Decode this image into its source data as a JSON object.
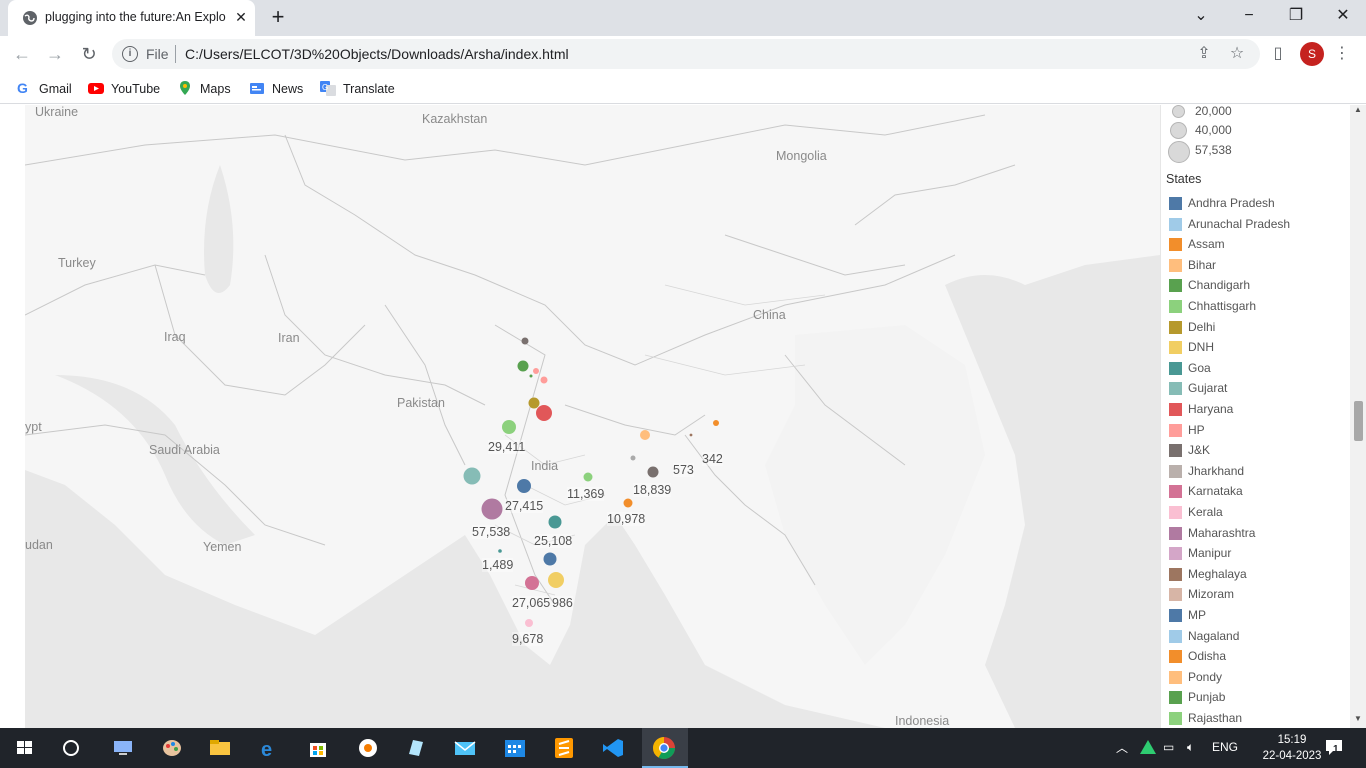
{
  "browser": {
    "tab_title": "plugging into the future:An Explo",
    "url_scheme": "File",
    "url": "C:/Users/ELCOT/3D%20Objects/Downloads/Arsha/index.html",
    "profile_initial": "S",
    "bookmarks": [
      {
        "label": "Gmail",
        "icon": "gmail-icon"
      },
      {
        "label": "YouTube",
        "icon": "youtube-icon"
      },
      {
        "label": "Maps",
        "icon": "maps-icon"
      },
      {
        "label": "News",
        "icon": "news-icon"
      },
      {
        "label": "Translate",
        "icon": "translate-icon"
      }
    ]
  },
  "map": {
    "geo_labels": [
      "Ukraine",
      "Kazakhstan",
      "Mongolia",
      "Turkey",
      "Iraq",
      "Iran",
      "China",
      "Pakistan",
      "ypt",
      "Saudi Arabia",
      "India",
      "Yemen",
      "udan",
      "Indonesia"
    ],
    "bubbles": [
      {
        "state": "Maharashtra",
        "value": 57538,
        "label": "57,538",
        "color": "#b07aa1"
      },
      {
        "state": "Haryana",
        "value": 29411,
        "label": "29,411",
        "color": "#e15759"
      },
      {
        "state": "MP",
        "value": 27415,
        "label": "27,415",
        "color": "#4e79a7"
      },
      {
        "state": "Karnataka",
        "value": 27065,
        "label": "27,065",
        "color": "#d4658c"
      },
      {
        "state": "Goa",
        "value": 25108,
        "label": "25,108",
        "color": "#499894"
      },
      {
        "state": "Jharkhand",
        "value": 18839,
        "label": "18,839",
        "color": "#79706e"
      },
      {
        "state": "Chhattisgarh",
        "value": 11369,
        "label": "11,369",
        "color": "#8cd17d"
      },
      {
        "state": "Odisha",
        "value": 10978,
        "label": "10,978",
        "color": "#f28e2b"
      },
      {
        "state": "Kerala",
        "value": 9678,
        "label": "9,678",
        "color": "#fabfd2"
      },
      {
        "state": "Goa",
        "value": 1489,
        "label": "1,489",
        "color": "#499894"
      },
      {
        "state": "DNH",
        "value": 986,
        "label": "986",
        "color": "#f1ce63"
      },
      {
        "state": "Meghalaya",
        "value": 573,
        "label": "573",
        "color": "#9d7660"
      },
      {
        "state": "Assam",
        "value": 342,
        "label": "342",
        "color": "#f28e2b"
      }
    ]
  },
  "legend": {
    "size_items": [
      "20,000",
      "40,000",
      "57,538"
    ],
    "states_title": "States",
    "states": [
      {
        "name": "Andhra Pradesh",
        "color": "#4e79a7"
      },
      {
        "name": "Arunachal Pradesh",
        "color": "#a0cbe8"
      },
      {
        "name": "Assam",
        "color": "#f28e2b"
      },
      {
        "name": "Bihar",
        "color": "#ffbe7d"
      },
      {
        "name": "Chandigarh",
        "color": "#59a14f"
      },
      {
        "name": "Chhattisgarh",
        "color": "#8cd17d"
      },
      {
        "name": "Delhi",
        "color": "#b6992d"
      },
      {
        "name": "DNH",
        "color": "#f1ce63"
      },
      {
        "name": "Goa",
        "color": "#499894"
      },
      {
        "name": "Gujarat",
        "color": "#86bcb6"
      },
      {
        "name": "Haryana",
        "color": "#e15759"
      },
      {
        "name": "HP",
        "color": "#ff9d9a"
      },
      {
        "name": "J&K",
        "color": "#79706e"
      },
      {
        "name": "Jharkhand",
        "color": "#bab0ac"
      },
      {
        "name": "Karnataka",
        "color": "#d37295"
      },
      {
        "name": "Kerala",
        "color": "#fabfd2"
      },
      {
        "name": "Maharashtra",
        "color": "#b07aa1"
      },
      {
        "name": "Manipur",
        "color": "#d4a6c8"
      },
      {
        "name": "Meghalaya",
        "color": "#9d7660"
      },
      {
        "name": "Mizoram",
        "color": "#d7b5a6"
      },
      {
        "name": "MP",
        "color": "#4e79a7"
      },
      {
        "name": "Nagaland",
        "color": "#a0cbe8"
      },
      {
        "name": "Odisha",
        "color": "#f28e2b"
      },
      {
        "name": "Pondy",
        "color": "#ffbe7d"
      },
      {
        "name": "Punjab",
        "color": "#59a14f"
      },
      {
        "name": "Rajasthan",
        "color": "#8cd17d"
      }
    ]
  },
  "taskbar": {
    "language": "ENG",
    "time": "15:19",
    "date": "22-04-2023",
    "notification_count": "1"
  }
}
